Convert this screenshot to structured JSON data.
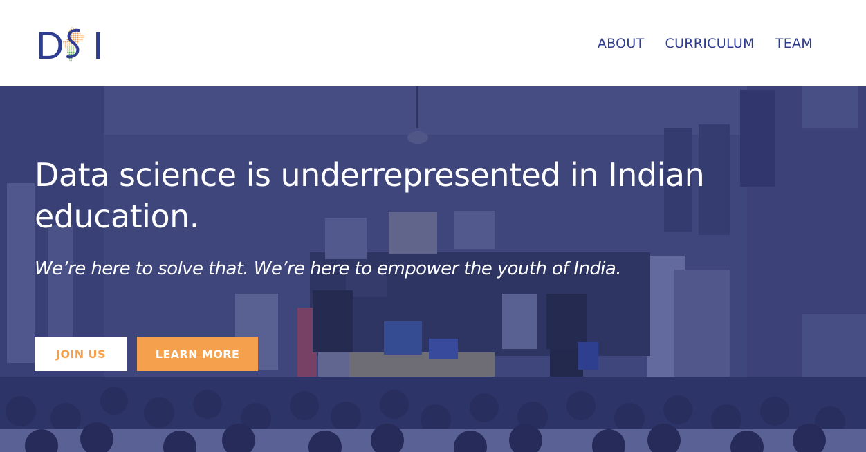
{
  "brand": {
    "logo_text": "DSI",
    "logo_letters": [
      "D",
      "S",
      "I"
    ]
  },
  "nav": {
    "items": [
      {
        "label": "ABOUT"
      },
      {
        "label": "CURRICULUM"
      },
      {
        "label": "TEAM"
      }
    ]
  },
  "hero": {
    "headline": "Data science is underrepresented in Indian education.",
    "subheadline": "We’re here to solve that. We’re here to empower the youth of India.",
    "join_button": "JOIN US",
    "learn_button": "LEARN MORE"
  },
  "colors": {
    "brand_blue": "#2e3d8f",
    "accent_orange": "#f5a04c",
    "overlay": "#2e3670",
    "white": "#ffffff"
  }
}
